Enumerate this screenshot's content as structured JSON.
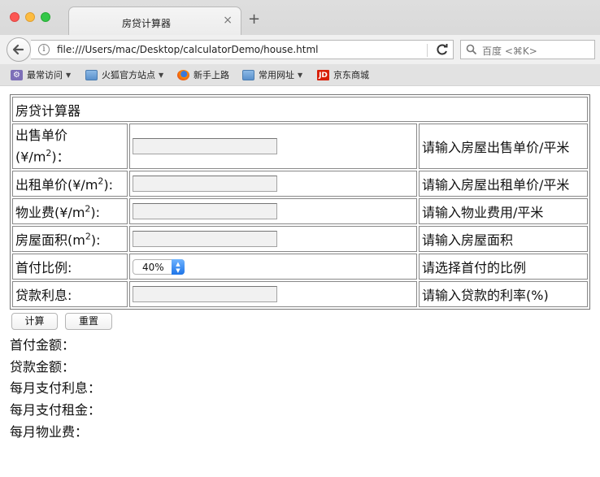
{
  "browser": {
    "tab_title": "房贷计算器",
    "tab_close": "×",
    "new_tab": "+",
    "url": "file:///Users/mac/Desktop/calculatorDemo/house.html",
    "search_placeholder": "百度 <⌘K>",
    "bookmarks": [
      {
        "label": "最常访问",
        "has_menu": true
      },
      {
        "label": "火狐官方站点",
        "has_menu": true
      },
      {
        "label": "新手上路",
        "has_menu": false
      },
      {
        "label": "常用网址",
        "has_menu": true
      },
      {
        "label": "京东商城",
        "has_menu": false
      }
    ]
  },
  "form": {
    "title": "房贷计算器",
    "rows": {
      "sale_price": {
        "label": "出售单价",
        "unit_prefix": "(¥/m",
        "unit_suffix": ")：",
        "sup": "2",
        "hint": "请输入房屋出售单价/平米"
      },
      "rent_price": {
        "label": "出租单价(¥/m",
        "sup": "2",
        "unit_suffix": "):",
        "hint": "请输入房屋出租单价/平米"
      },
      "property_fee": {
        "label": "物业费(¥/m",
        "sup": "2",
        "unit_suffix": "):",
        "hint": "请输入物业费用/平米"
      },
      "area": {
        "label": "房屋面积(m",
        "sup": "2",
        "unit_suffix": "):",
        "hint": "请输入房屋面积"
      },
      "down_ratio": {
        "label": "首付比例:",
        "selected": "40%",
        "hint": "请选择首付的比例"
      },
      "interest": {
        "label": "贷款利息:",
        "hint": "请输入贷款的利率(%)"
      }
    },
    "calculate_label": "计算",
    "reset_label": "重置"
  },
  "results": [
    "首付金额：",
    "贷款金额：",
    "每月支付利息：",
    "每月支付租金：",
    "每月物业费："
  ]
}
